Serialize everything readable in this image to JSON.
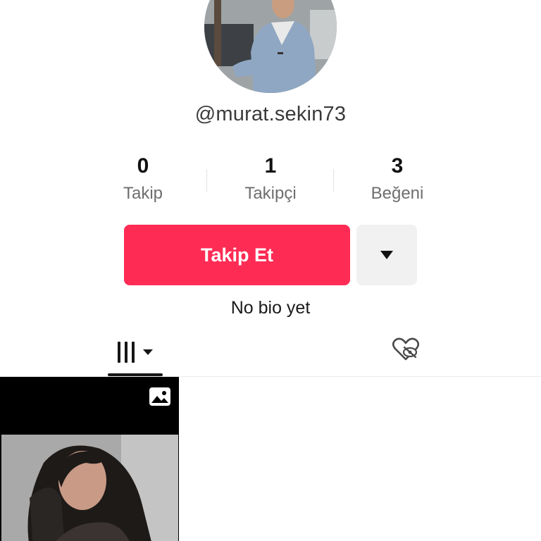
{
  "profile": {
    "username": "@murat.sekin73",
    "bio": "No bio yet"
  },
  "stats": [
    {
      "value": "0",
      "label": "Takip"
    },
    {
      "value": "1",
      "label": "Takipçi"
    },
    {
      "value": "3",
      "label": "Beğeni"
    }
  ],
  "actions": {
    "follow_label": "Takip Et",
    "more_icon": "caret-down-icon"
  },
  "tabs": {
    "videos_icon": "grid-icon",
    "liked_icon": "hidden-heart-icon"
  },
  "videos": [
    {
      "type": "photo",
      "badge_icon": "image-icon"
    }
  ],
  "colors": {
    "accent": "#fe2c55",
    "secondary_button": "#f1f1f2",
    "text_primary": "#111111",
    "text_muted": "#6e6e6e"
  }
}
